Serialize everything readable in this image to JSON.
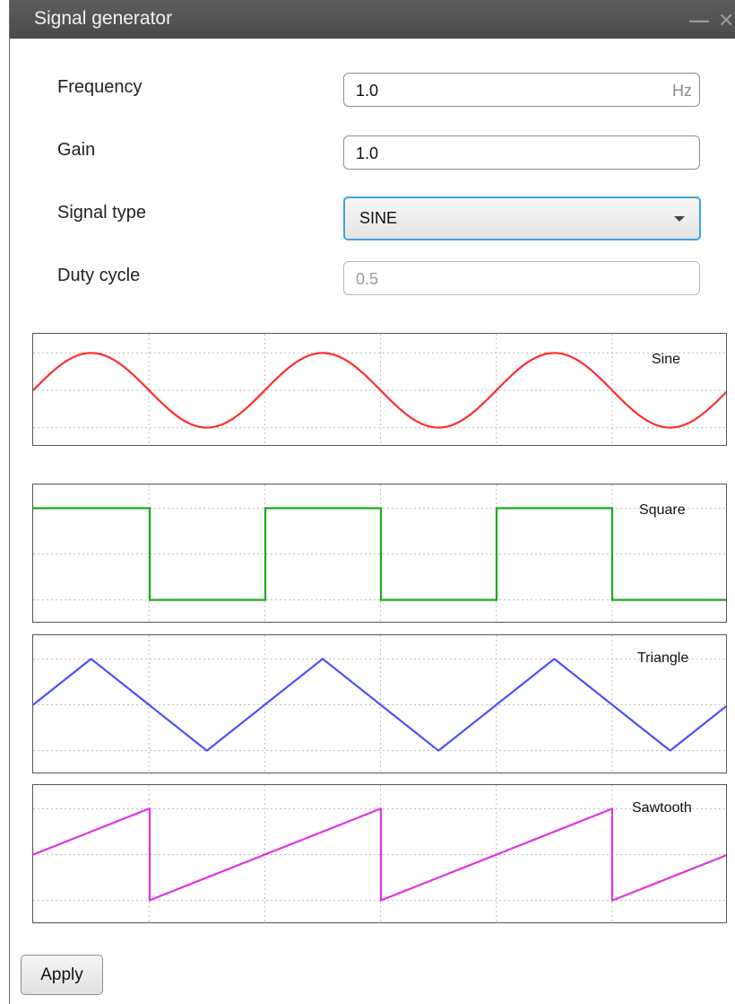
{
  "window": {
    "title": "Signal generator",
    "minimize_glyph": "—",
    "close_glyph": "✕"
  },
  "form": {
    "frequency": {
      "label": "Frequency",
      "value": "1.0",
      "unit": "Hz"
    },
    "gain": {
      "label": "Gain",
      "value": "1.0"
    },
    "signal_type": {
      "label": "Signal type",
      "value": "SINE"
    },
    "duty_cycle": {
      "label": "Duty cycle",
      "value": "0.5"
    }
  },
  "plots": [
    {
      "label": "Sine",
      "color": "#ff2d2d"
    },
    {
      "label": "Square",
      "color": "#1aab1a"
    },
    {
      "label": "Triangle",
      "color": "#4b50ff"
    },
    {
      "label": "Sawtooth",
      "color": "#e033e0"
    }
  ],
  "chart_data": [
    {
      "type": "line",
      "title": "Sine",
      "waveform": "sine",
      "periods": 3,
      "series": [
        {
          "name": "Sine"
        }
      ]
    },
    {
      "type": "line",
      "title": "Square",
      "waveform": "square",
      "periods": 3,
      "duty_cycle": 0.5,
      "series": [
        {
          "name": "Square"
        }
      ]
    },
    {
      "type": "line",
      "title": "Triangle",
      "waveform": "triangle",
      "periods": 3,
      "series": [
        {
          "name": "Triangle"
        }
      ]
    },
    {
      "type": "line",
      "title": "Sawtooth",
      "waveform": "sawtooth",
      "periods": 3,
      "series": [
        {
          "name": "Sawtooth"
        }
      ]
    }
  ],
  "buttons": {
    "apply": "Apply"
  }
}
